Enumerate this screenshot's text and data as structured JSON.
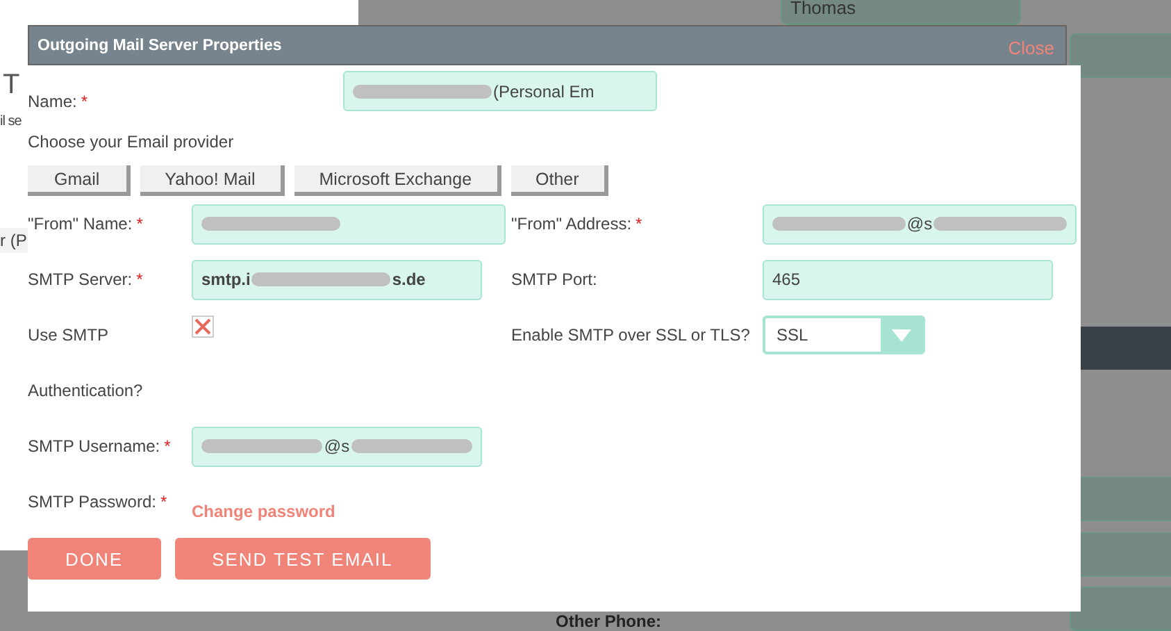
{
  "background": {
    "texts": [
      {
        "kind": "heading",
        "text": "T"
      },
      {
        "kind": "line",
        "text": "il se"
      },
      {
        "kind": "cell",
        "text": "r (P"
      },
      {
        "kind": "field",
        "text": "Thomas"
      },
      {
        "kind": "label",
        "text": "Other Phone:"
      }
    ]
  },
  "dialog": {
    "title": "Outgoing Mail Server Properties",
    "close": "Close",
    "name_field": {
      "label": "Name:",
      "required_mark": "*",
      "value": [
        {
          "kind": "redacted"
        },
        {
          "kind": "text",
          "text": "(Personal Em"
        }
      ]
    },
    "provider_prompt": "Choose your Email provider",
    "providers": [
      "Gmail",
      "Yahoo! Mail",
      "Microsoft Exchange",
      "Other"
    ],
    "rows": [
      {
        "left": {
          "label": "\"From\" Name:",
          "required_mark": "*",
          "kind": "field",
          "value": [
            {
              "kind": "redacted"
            }
          ]
        },
        "right": {
          "label": "\"From\" Address:",
          "required_mark": "*",
          "kind": "field",
          "value": [
            {
              "kind": "redacted"
            },
            {
              "kind": "text",
              "text": "@s"
            },
            {
              "kind": "redacted"
            }
          ]
        }
      },
      {
        "left": {
          "label": "SMTP Server:",
          "required_mark": "*",
          "kind": "field",
          "bold": true,
          "value": [
            {
              "kind": "text",
              "text": "smtp.i"
            },
            {
              "kind": "redacted"
            },
            {
              "kind": "text",
              "text": "s.de"
            }
          ]
        },
        "right": {
          "label": "SMTP Port:",
          "kind": "short-field",
          "value": [
            {
              "kind": "text",
              "text": "465"
            }
          ]
        }
      },
      {
        "left": {
          "label": "Use SMTP",
          "kind": "checkbox",
          "checked": true
        },
        "right": {
          "label": "Enable SMTP over SSL or TLS?",
          "kind": "select",
          "value": [
            {
              "kind": "text",
              "text": "SSL"
            }
          ]
        }
      },
      {
        "left": {
          "label": "Authentication?",
          "kind": "none"
        }
      },
      {
        "left": {
          "label": "SMTP Username:",
          "required_mark": "*",
          "kind": "field",
          "value": [
            {
              "kind": "redacted"
            },
            {
              "kind": "text",
              "text": "@s"
            },
            {
              "kind": "redacted"
            }
          ]
        }
      },
      {
        "left": {
          "label": "SMTP Password:",
          "required_mark": "*",
          "kind": "link",
          "text": "Change password"
        }
      }
    ],
    "buttons": [
      "DONE",
      "SEND TEST EMAIL"
    ]
  }
}
